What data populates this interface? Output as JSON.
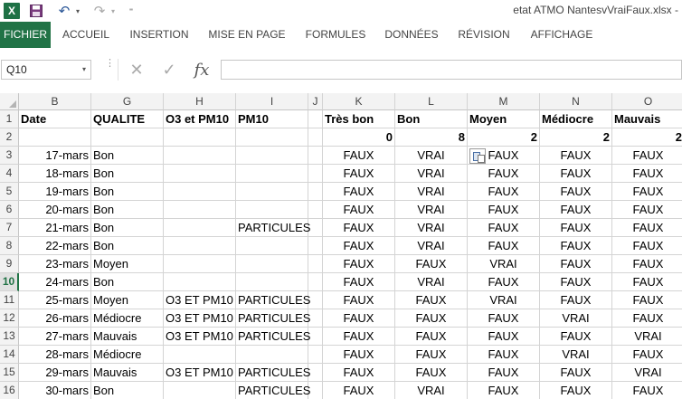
{
  "window": {
    "title": "etat ATMO NantesvVraiFaux.xlsx -"
  },
  "qat": {
    "excel_icon": "X",
    "save_icon": "floppy-disk",
    "undo_glyph": "↶",
    "redo_glyph": "↷",
    "dropdown_glyph": "▾",
    "customize_glyph": "⁼"
  },
  "ribbon": {
    "tabs": [
      "FICHIER",
      "ACCUEIL",
      "INSERTION",
      "MISE EN PAGE",
      "FORMULES",
      "DONNÉES",
      "RÉVISION",
      "AFFICHAGE"
    ]
  },
  "formula_bar": {
    "name_box": "Q10",
    "dropdown_glyph": "▾",
    "cancel_glyph": "✕",
    "enter_glyph": "✓",
    "fx_label": "fx",
    "value": ""
  },
  "colors": {
    "accent": "#217346",
    "excel_green": "#1e7145",
    "grid_line": "#d4d4d4"
  },
  "sheet": {
    "selected_row": "10",
    "columns": [
      "B",
      "G",
      "H",
      "I",
      "J",
      "K",
      "L",
      "M",
      "N",
      "O"
    ],
    "row_numbers": [
      "1",
      "2",
      "3",
      "4",
      "5",
      "6",
      "7",
      "8",
      "9",
      "10",
      "11",
      "12",
      "13",
      "14",
      "15",
      "16"
    ],
    "rows": [
      [
        "Date",
        "QUALITE",
        "O3 et PM10",
        "PM10",
        "",
        "Très bon",
        "Bon",
        "Moyen",
        "Médiocre",
        "Mauvais"
      ],
      [
        "",
        "",
        "",
        "",
        "",
        "0",
        "8",
        "2",
        "2",
        "2"
      ],
      [
        "17-mars",
        "Bon",
        "",
        "",
        "",
        "FAUX",
        "VRAI",
        "FAUX",
        "FAUX",
        "FAUX"
      ],
      [
        "18-mars",
        "Bon",
        "",
        "",
        "",
        "FAUX",
        "VRAI",
        "FAUX",
        "FAUX",
        "FAUX"
      ],
      [
        "19-mars",
        "Bon",
        "",
        "",
        "",
        "FAUX",
        "VRAI",
        "FAUX",
        "FAUX",
        "FAUX"
      ],
      [
        "20-mars",
        "Bon",
        "",
        "",
        "",
        "FAUX",
        "VRAI",
        "FAUX",
        "FAUX",
        "FAUX"
      ],
      [
        "21-mars",
        "Bon",
        "",
        "PARTICULES",
        "",
        "FAUX",
        "VRAI",
        "FAUX",
        "FAUX",
        "FAUX"
      ],
      [
        "22-mars",
        "Bon",
        "",
        "",
        "",
        "FAUX",
        "VRAI",
        "FAUX",
        "FAUX",
        "FAUX"
      ],
      [
        "23-mars",
        "Moyen",
        "",
        "",
        "",
        "FAUX",
        "FAUX",
        "VRAI",
        "FAUX",
        "FAUX"
      ],
      [
        "24-mars",
        "Bon",
        "",
        "",
        "",
        "FAUX",
        "VRAI",
        "FAUX",
        "FAUX",
        "FAUX"
      ],
      [
        "25-mars",
        "Moyen",
        "O3 ET PM10",
        "PARTICULES",
        "",
        "FAUX",
        "FAUX",
        "VRAI",
        "FAUX",
        "FAUX"
      ],
      [
        "26-mars",
        "Médiocre",
        "O3 ET PM10",
        "PARTICULES",
        "",
        "FAUX",
        "FAUX",
        "FAUX",
        "VRAI",
        "FAUX"
      ],
      [
        "27-mars",
        "Mauvais",
        "O3 ET PM10",
        "PARTICULES",
        "",
        "FAUX",
        "FAUX",
        "FAUX",
        "FAUX",
        "VRAI"
      ],
      [
        "28-mars",
        "Médiocre",
        "",
        "",
        "",
        "FAUX",
        "FAUX",
        "FAUX",
        "VRAI",
        "FAUX"
      ],
      [
        "29-mars",
        "Mauvais",
        "O3 ET PM10",
        "PARTICULES",
        "",
        "FAUX",
        "FAUX",
        "FAUX",
        "FAUX",
        "VRAI"
      ],
      [
        "30-mars",
        "Bon",
        "",
        "PARTICULES",
        "",
        "FAUX",
        "VRAI",
        "FAUX",
        "FAUX",
        "FAUX"
      ]
    ]
  }
}
